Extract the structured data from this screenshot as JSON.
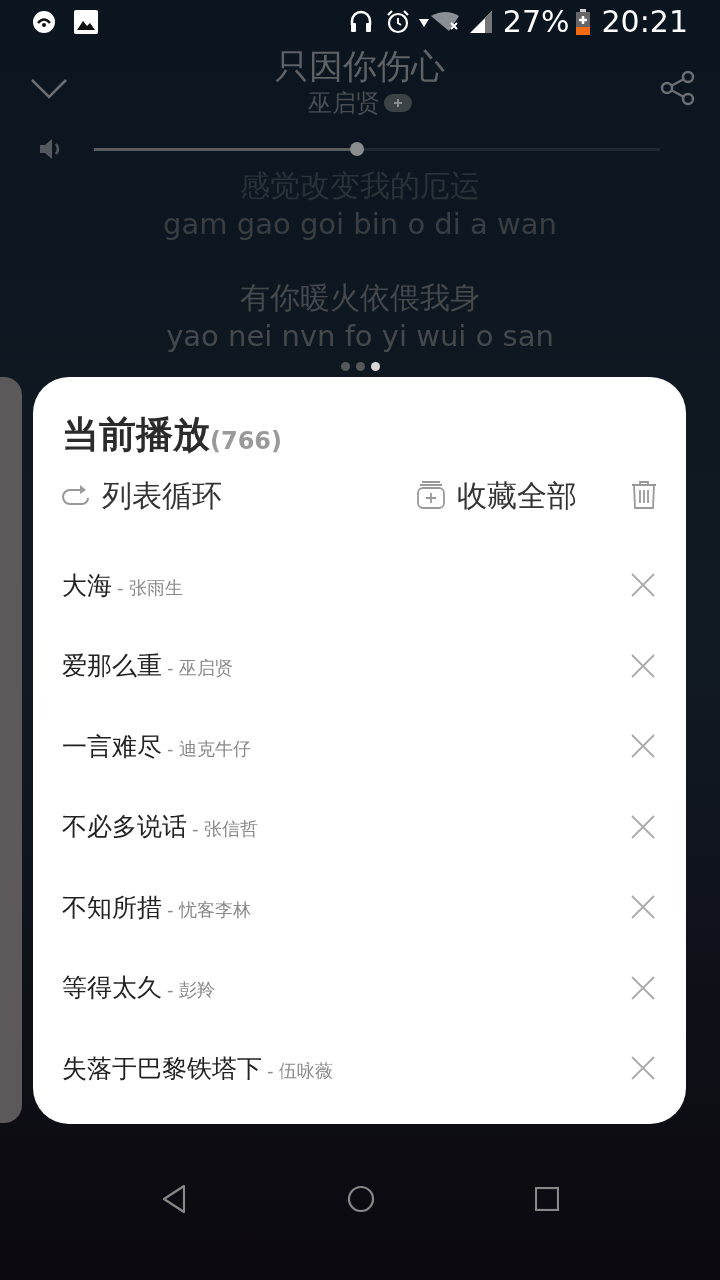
{
  "status_bar": {
    "battery": "27%",
    "time": "20:21"
  },
  "song": {
    "title": "只因你伤心",
    "artist": "巫启贤",
    "volume": {
      "level": 0.465
    }
  },
  "lyrics": [
    {
      "text": "感觉改变我的厄运",
      "pinyin": "gam gao goi bin o di a wan"
    },
    {
      "text": "有你暖火依偎我身",
      "pinyin": "yao nei nvn fo yi wui o san"
    }
  ],
  "pages": [
    {
      "selected": false
    },
    {
      "selected": false
    },
    {
      "selected": true
    }
  ],
  "playlist": {
    "title": "当前播放",
    "count": "(766)",
    "mode": "列表循环",
    "collect_all": "收藏全部",
    "songs": [
      {
        "title": "大海",
        "artist": "- 张雨生"
      },
      {
        "title": "爱那么重",
        "artist": "- 巫启贤"
      },
      {
        "title": "一言难尽",
        "artist": "- 迪克牛仔"
      },
      {
        "title": "不必多说话",
        "artist": "- 张信哲"
      },
      {
        "title": "不知所措",
        "artist": "- 忧客李林"
      },
      {
        "title": "等得太久",
        "artist": "- 彭羚"
      },
      {
        "title": "失落于巴黎铁塔下",
        "artist": "- 伍咏薇"
      }
    ]
  }
}
